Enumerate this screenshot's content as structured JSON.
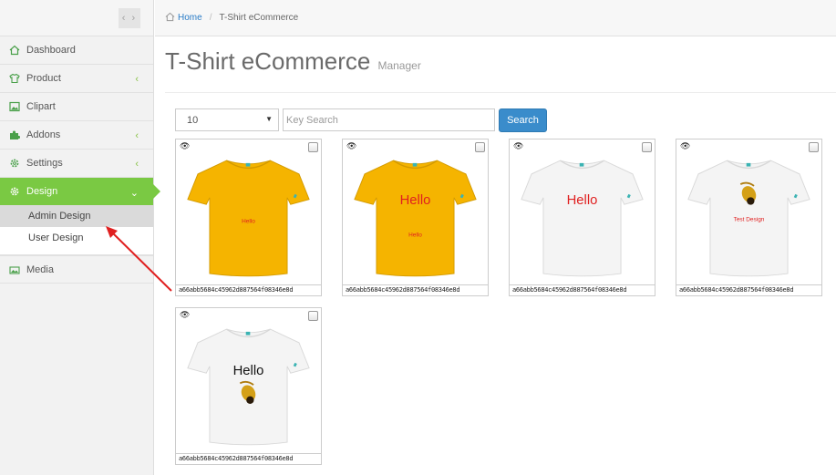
{
  "sidebar": {
    "items": [
      {
        "label": "Dashboard",
        "icon": "home-icon"
      },
      {
        "label": "Product",
        "icon": "tshirt-icon"
      },
      {
        "label": "Clipart",
        "icon": "image-icon"
      },
      {
        "label": "Addons",
        "icon": "puzzle-icon"
      },
      {
        "label": "Settings",
        "icon": "gear-icon"
      },
      {
        "label": "Design",
        "icon": "gear-icon"
      }
    ],
    "sub_items": [
      "Admin Design",
      "User Design"
    ],
    "media": {
      "label": "Media",
      "icon": "photos-icon"
    },
    "chevron": "‹",
    "chevron_down": "⌄"
  },
  "breadcrumb": {
    "home": "Home",
    "current": "T-Shirt eCommerce",
    "sep": "/"
  },
  "header": {
    "title": "T-Shirt eCommerce",
    "subtitle": "Manager"
  },
  "controls": {
    "page_size": "10",
    "search_placeholder": "Key Search",
    "search_label": "Search"
  },
  "designs": [
    {
      "id": "a66abb5684c45962d887564f08346e8d",
      "color": "#f5b400",
      "big": "",
      "small": "Hello",
      "clip": false
    },
    {
      "id": "a66abb5684c45962d887564f08346e8d",
      "color": "#f5b400",
      "big": "Hello",
      "small": "Hello",
      "clip": false
    },
    {
      "id": "a66abb5684c45962d887564f08346e8d",
      "color": "#f4f4f4",
      "big": "Hello",
      "small": "",
      "clip": false
    },
    {
      "id": "a66abb5684c45962d887564f08346e8d",
      "color": "#f4f4f4",
      "big": "",
      "small": "Test Design",
      "clip": true
    },
    {
      "id": "a66abb5684c45962d887564f08346e8d",
      "color": "#f4f4f4",
      "big": "Hello",
      "small": "",
      "clip": true
    }
  ],
  "colors": {
    "active": "#7ac943",
    "primary": "#3a8ccb",
    "text_red": "#e02020"
  }
}
